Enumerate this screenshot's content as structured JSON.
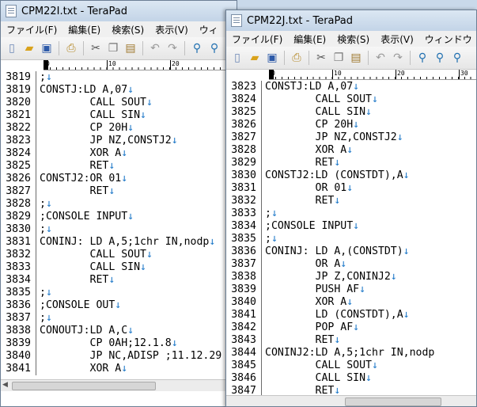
{
  "windows": [
    {
      "title": "CPM22I.txt - TeraPad",
      "menu": [
        "ファイル(F)",
        "編集(E)",
        "検索(S)",
        "表示(V)",
        "ウィ"
      ],
      "ruler": [
        "0",
        "10",
        "20"
      ],
      "lines": [
        {
          "n": "3819",
          "t": ";",
          "e": "↓"
        },
        {
          "n": "3819",
          "t": "CONSTJ:LD A,07",
          "e": "↓"
        },
        {
          "n": "3820",
          "t": "        CALL SOUT",
          "e": "↓"
        },
        {
          "n": "3821",
          "t": "        CALL SIN",
          "e": "↓"
        },
        {
          "n": "3822",
          "t": "        CP 20H",
          "e": "↓"
        },
        {
          "n": "3823",
          "t": "        JP NZ,CONSTJ2",
          "e": "↓"
        },
        {
          "n": "3824",
          "t": "        XOR A",
          "e": "↓"
        },
        {
          "n": "3825",
          "t": "        RET",
          "e": "↓"
        },
        {
          "n": "3826",
          "t": "CONSTJ2:OR 01",
          "e": "↓"
        },
        {
          "n": "3827",
          "t": "        RET",
          "e": "↓"
        },
        {
          "n": "3828",
          "t": ";",
          "e": "↓"
        },
        {
          "n": "3829",
          "t": ";CONSOLE INPUT",
          "e": "↓"
        },
        {
          "n": "3830",
          "t": ";",
          "e": "↓"
        },
        {
          "n": "3831",
          "t": "CONINJ: LD A,5;1chr IN,nodp",
          "e": "↓"
        },
        {
          "n": "3832",
          "t": "        CALL SOUT",
          "e": "↓"
        },
        {
          "n": "3833",
          "t": "        CALL SIN",
          "e": "↓"
        },
        {
          "n": "3834",
          "t": "        RET",
          "e": "↓"
        },
        {
          "n": "3835",
          "t": ";",
          "e": "↓"
        },
        {
          "n": "3836",
          "t": ";CONSOLE OUT",
          "e": "↓"
        },
        {
          "n": "3837",
          "t": ";",
          "e": "↓"
        },
        {
          "n": "3838",
          "t": "CONOUTJ:LD A,C",
          "e": "↓"
        },
        {
          "n": "3839",
          "t": "        CP 0AH;12.1.8",
          "e": "↓"
        },
        {
          "n": "3840",
          "t": "        JP NC,ADISP ;11.12.29",
          "e": ""
        },
        {
          "n": "3841",
          "t": "        XOR A",
          "e": "↓"
        }
      ]
    },
    {
      "title": "CPM22J.txt - TeraPad",
      "menu": [
        "ファイル(F)",
        "編集(E)",
        "検索(S)",
        "表示(V)",
        "ウィンドウ"
      ],
      "ruler": [
        "0",
        "10",
        "20",
        "30"
      ],
      "lines": [
        {
          "n": "3823",
          "t": "CONSTJ:LD A,07",
          "e": "↓"
        },
        {
          "n": "3824",
          "t": "        CALL SOUT",
          "e": "↓"
        },
        {
          "n": "3825",
          "t": "        CALL SIN",
          "e": "↓"
        },
        {
          "n": "3826",
          "t": "        CP 20H",
          "e": "↓"
        },
        {
          "n": "3827",
          "t": "        JP NZ,CONSTJ2",
          "e": "↓"
        },
        {
          "n": "3828",
          "t": "        XOR A",
          "e": "↓"
        },
        {
          "n": "3829",
          "t": "        RET",
          "e": "↓"
        },
        {
          "n": "3830",
          "t": "CONSTJ2:LD (CONSTDT),A",
          "e": "↓"
        },
        {
          "n": "3831",
          "t": "        OR 01",
          "e": "↓"
        },
        {
          "n": "3832",
          "t": "        RET",
          "e": "↓"
        },
        {
          "n": "3833",
          "t": ";",
          "e": "↓"
        },
        {
          "n": "3834",
          "t": ";CONSOLE INPUT",
          "e": "↓"
        },
        {
          "n": "3835",
          "t": ";",
          "e": "↓"
        },
        {
          "n": "3836",
          "t": "CONINJ: LD A,(CONSTDT)",
          "e": "↓"
        },
        {
          "n": "3837",
          "t": "        OR A",
          "e": "↓"
        },
        {
          "n": "3838",
          "t": "        JP Z,CONINJ2",
          "e": "↓"
        },
        {
          "n": "3839",
          "t": "        PUSH AF",
          "e": "↓"
        },
        {
          "n": "3840",
          "t": "        XOR A",
          "e": "↓"
        },
        {
          "n": "3841",
          "t": "        LD (CONSTDT),A",
          "e": "↓"
        },
        {
          "n": "3842",
          "t": "        POP AF",
          "e": "↓"
        },
        {
          "n": "3843",
          "t": "        RET",
          "e": "↓"
        },
        {
          "n": "3844",
          "t": "CONINJ2:LD A,5;1chr IN,nodp",
          "e": ""
        },
        {
          "n": "3845",
          "t": "        CALL SOUT",
          "e": "↓"
        },
        {
          "n": "3846",
          "t": "        CALL SIN",
          "e": "↓"
        },
        {
          "n": "3847",
          "t": "        RET",
          "e": "↓"
        }
      ]
    }
  ],
  "colors": {
    "eol_mark": "#1e78c8",
    "titlebar": "#c3d4e7"
  }
}
